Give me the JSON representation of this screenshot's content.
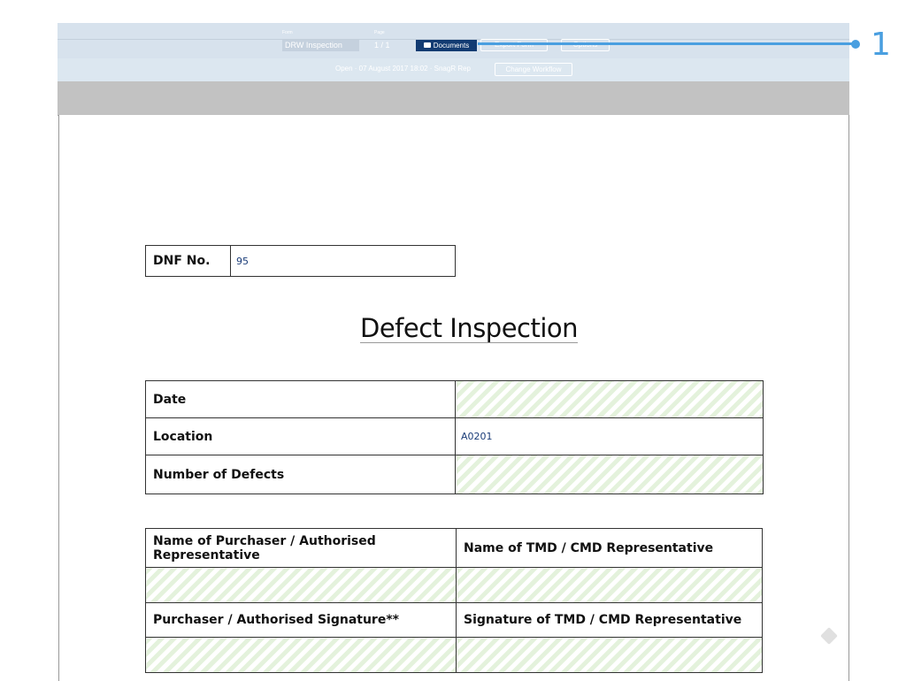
{
  "toolbar": {
    "form_label": "Form",
    "form_value": "DRW Inspection",
    "page_label": "Page",
    "page_value": "1 / 1",
    "documents_label": "Documents",
    "export_label": "Export Form",
    "options_label": "Options"
  },
  "status": {
    "text": "Open · 07 August 2017 18:02 · SnagR Rep",
    "workflow_label": "Change Workflow"
  },
  "callout": {
    "number": "1"
  },
  "document": {
    "dnf_label": "DNF No.",
    "dnf_value": "95",
    "title": "Defect Inspection",
    "info_rows": [
      {
        "label": "Date",
        "value": ""
      },
      {
        "label": "Location",
        "value": "A0201"
      },
      {
        "label": "Number of Defects",
        "value": ""
      }
    ],
    "rep_headers": [
      "Name of Purchaser / Authorised Representative",
      "Name of TMD / CMD Representative"
    ],
    "sig_headers": [
      "Purchaser / Authorised Signature**",
      "Signature of TMD / CMD Representative"
    ]
  }
}
